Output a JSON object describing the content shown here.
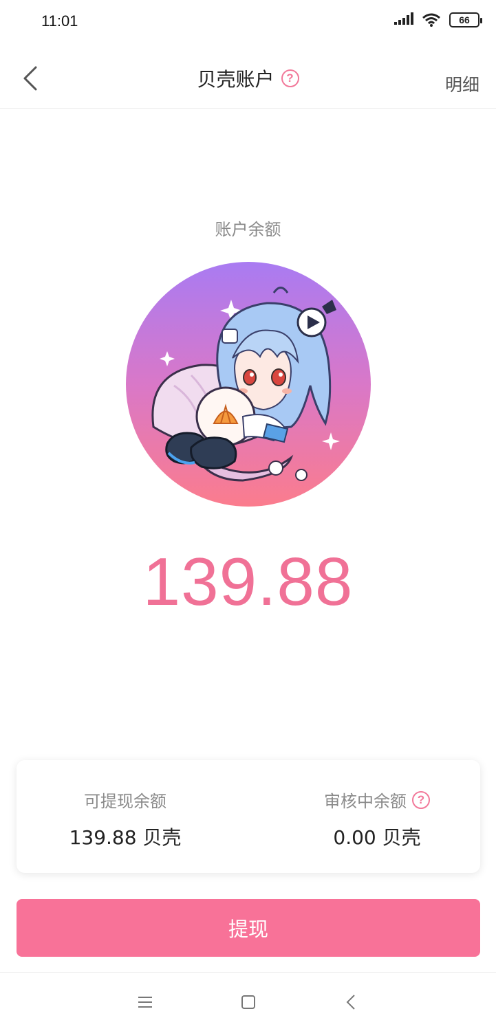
{
  "status_bar": {
    "time": "11:01",
    "battery": "66"
  },
  "nav": {
    "title": "贝壳账户",
    "detail_label": "明细",
    "help_icon": "question-circle-icon"
  },
  "balance": {
    "label": "账户余额",
    "amount": "139.88"
  },
  "card": {
    "withdrawable_label": "可提现余额",
    "withdrawable_value": "139.88 贝壳",
    "pending_label": "审核中余额",
    "pending_value": "0.00 贝壳"
  },
  "actions": {
    "withdraw_label": "提现"
  },
  "colors": {
    "accent": "#f87298",
    "amount": "#f07196",
    "gradient_top": "#a97bf2",
    "gradient_bottom": "#fb7c8d"
  }
}
